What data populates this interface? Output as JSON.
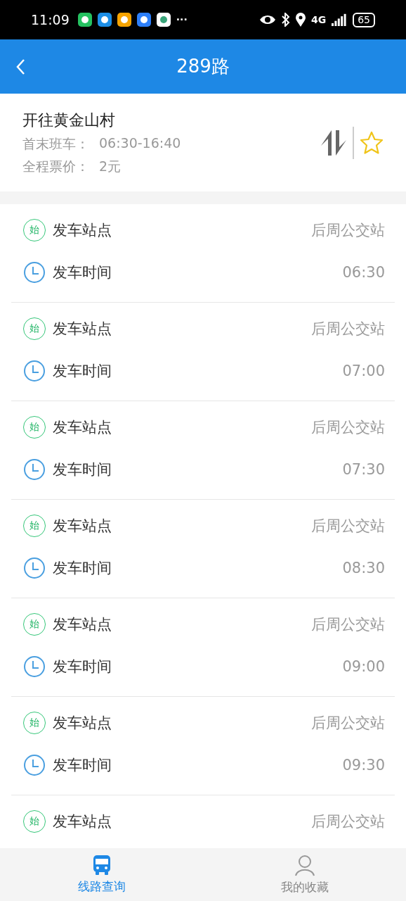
{
  "status_bar": {
    "time": "11:09",
    "more": "···",
    "network": "4G",
    "battery": "65"
  },
  "header": {
    "title": "289路"
  },
  "route": {
    "direction": "开往黄金山村",
    "hours_label": "首末班车：",
    "hours": "06:30-16:40",
    "fare_label": "全程票价：",
    "fare": "2元",
    "favorite": false
  },
  "departures": [
    {
      "badge": "始",
      "station_label": "发车站点",
      "station": "后周公交站",
      "time_label": "发车时间",
      "time": "06:30"
    },
    {
      "badge": "始",
      "station_label": "发车站点",
      "station": "后周公交站",
      "time_label": "发车时间",
      "time": "07:00"
    },
    {
      "badge": "始",
      "station_label": "发车站点",
      "station": "后周公交站",
      "time_label": "发车时间",
      "time": "07:30"
    },
    {
      "badge": "始",
      "station_label": "发车站点",
      "station": "后周公交站",
      "time_label": "发车时间",
      "time": "08:30"
    },
    {
      "badge": "始",
      "station_label": "发车站点",
      "station": "后周公交站",
      "time_label": "发车时间",
      "time": "09:00"
    },
    {
      "badge": "始",
      "station_label": "发车站点",
      "station": "后周公交站",
      "time_label": "发车时间",
      "time": "09:30"
    },
    {
      "badge": "始",
      "station_label": "发车站点",
      "station": "后周公交站"
    }
  ],
  "tabs": [
    {
      "label": "线路查询",
      "kind": "bus",
      "selected": true
    },
    {
      "label": "我的收藏",
      "kind": "person",
      "selected": false
    }
  ]
}
